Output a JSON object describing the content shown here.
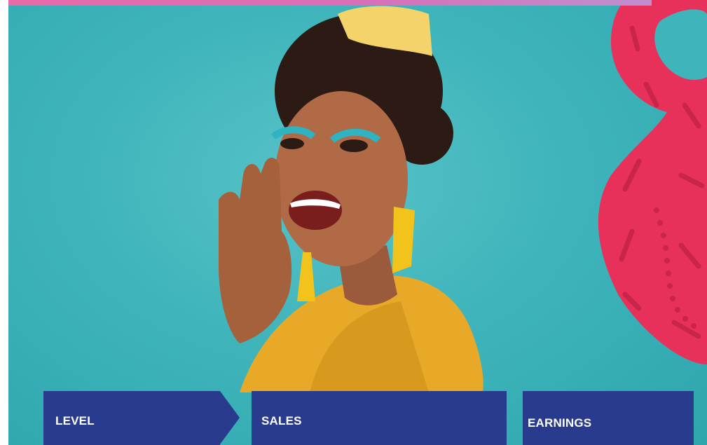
{
  "hero": {
    "image": "photo-woman-shouting-teal-background",
    "colors": {
      "background": "#3fb4bb",
      "accent_shape": "#e8315a",
      "top_band": "#e86aa8",
      "card": "#283b8c"
    }
  },
  "cards": {
    "level": "LEVEL",
    "sales": "SALES",
    "earnings": "EARNINGS"
  }
}
